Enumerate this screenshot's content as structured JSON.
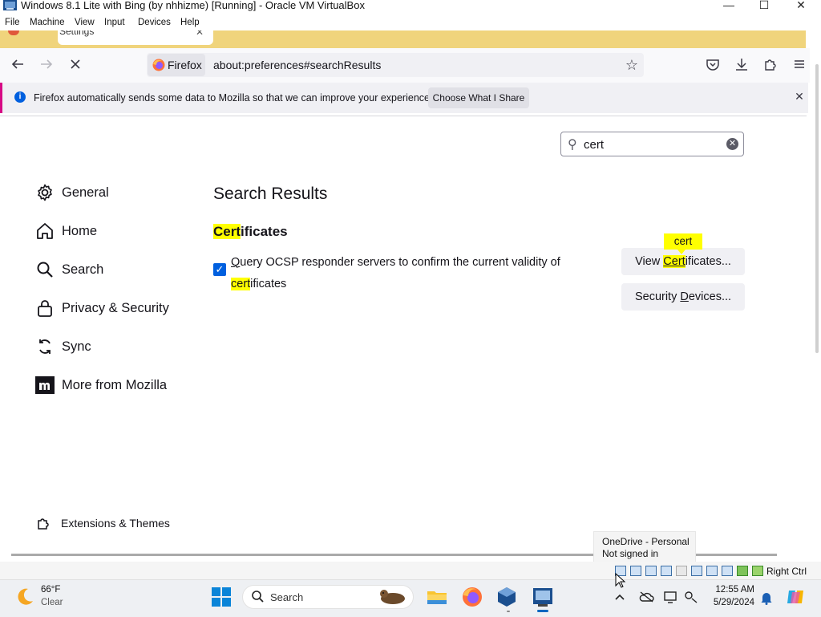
{
  "vbox": {
    "title": "Windows 8.1 Lite with Bing (by nhhizme) [Running] - Oracle VM VirtualBox",
    "minimize": "—",
    "maximize": "☐",
    "close": "✕",
    "menu": [
      "File",
      "Machine",
      "View",
      "Input",
      "Devices",
      "Help"
    ],
    "host_key_label": "Right Ctrl"
  },
  "browser": {
    "tab_label": "Settings",
    "tab_close": "✕",
    "identity_label": "Firefox",
    "url": "about:preferences#searchResults",
    "notification": {
      "text": "Firefox automatically sends some data to Mozilla so that we can improve your experience.",
      "button": "Choose What I Share",
      "close": "✕"
    }
  },
  "prefs": {
    "search_value": "cert",
    "categories": [
      {
        "label": "General",
        "icon": "gear-icon"
      },
      {
        "label": "Home",
        "icon": "home-icon"
      },
      {
        "label": "Search",
        "icon": "search-icon"
      },
      {
        "label": "Privacy & Security",
        "icon": "lock-icon"
      },
      {
        "label": "Sync",
        "icon": "sync-icon"
      },
      {
        "label": "More from Mozilla",
        "icon": "mozilla-icon"
      }
    ],
    "extensions_label": "Extensions & Themes",
    "results_title": "Search Results",
    "section": {
      "highlight": "Cert",
      "rest": "ificates"
    },
    "ocsp": {
      "checked": true,
      "text_start": "Query OCSP responder servers to confirm the current validity of ",
      "highlight": "cert",
      "text_end": "ificates"
    },
    "view_certs": {
      "prefix": "View ",
      "highlight": "Cert",
      "suffix": "ificates..."
    },
    "security_devices": {
      "prefix": "Security ",
      "underline": "D",
      "suffix": "evices..."
    },
    "tooltip": "cert"
  },
  "onedrive_tip": {
    "line1": "OneDrive - Personal",
    "line2": "Not signed in"
  },
  "taskbar": {
    "weather_temp": "66°F",
    "weather_cond": "Clear",
    "search_label": "Search",
    "time": "12:55 AM",
    "date": "5/29/2024"
  },
  "colors": {
    "accent": "#0060df",
    "highlight": "#ffff00",
    "tabstrip": "#f0d47c",
    "notif_border": "#d70a85"
  }
}
